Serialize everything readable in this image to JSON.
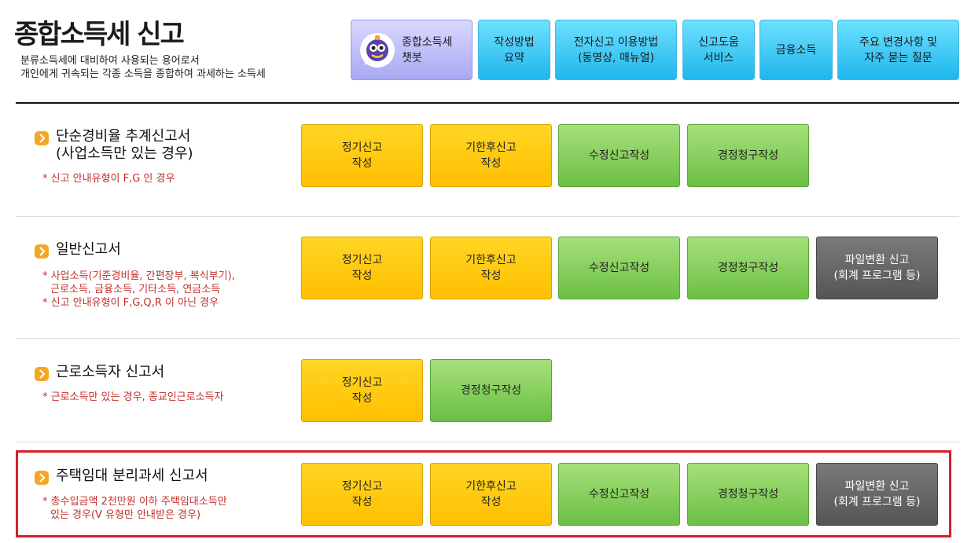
{
  "header": {
    "title": "종합소득세 신고",
    "desc_line1": "분류소득세에 대비하여 사용되는 용어로서",
    "desc_line2": "개인에게 귀속되는 각종 소득을 종합하여 과세하는 소득세"
  },
  "top_buttons": [
    {
      "label": "종합소득세\n챗봇",
      "icon": "chatbot-icon"
    },
    {
      "label": "작성방법\n요약"
    },
    {
      "label": "전자신고 이용방법\n(동영상, 매뉴얼)"
    },
    {
      "label": "신고도움\n서비스"
    },
    {
      "label": "금융소득"
    },
    {
      "label": "주요 변경사항 및\n자주 묻는 질문"
    }
  ],
  "sections": [
    {
      "title_line1": "단순경비율 추계신고서",
      "title_line2": "(사업소득만 있는 경우)",
      "notes": [
        "* 신고 안내유형이 F,G 인 경우"
      ],
      "buttons": [
        "정기신고\n작성",
        "기한후신고\n작성",
        "수정신고작성",
        "경정청구작성"
      ]
    },
    {
      "title_line1": "일반신고서",
      "notes": [
        "* 사업소득(기준경비율, 간편장부, 복식부기),",
        "근로소득, 금융소득, 기타소득, 연금소득",
        "* 신고 안내유형이 F,G,Q,R 이 아닌 경우"
      ],
      "buttons": [
        "정기신고\n작성",
        "기한후신고\n작성",
        "수정신고작성",
        "경정청구작성",
        "파일변환 신고\n(회계 프로그램 등)"
      ]
    },
    {
      "title_line1": "근로소득자 신고서",
      "notes": [
        "* 근로소득만 있는 경우, 종교인근로소득자"
      ],
      "buttons": [
        "정기신고\n작성",
        "경정청구작성"
      ]
    },
    {
      "title_line1": "주택임대 분리과세 신고서",
      "notes": [
        "* 총수입금액 2천만원 이하 주택임대소득만",
        "있는 경우(V 유형만 안내받은 경우)"
      ],
      "buttons": [
        "정기신고\n작성",
        "기한후신고\n작성",
        "수정신고작성",
        "경정청구작성",
        "파일변환 신고\n(회계 프로그램 등)"
      ]
    }
  ],
  "colors": {
    "accent_red": "#d4202a",
    "note_red": "#c0312c",
    "yellow": "#ffc800",
    "green": "#7cc853",
    "gray": "#666666",
    "cyan": "#2fc0f0"
  }
}
